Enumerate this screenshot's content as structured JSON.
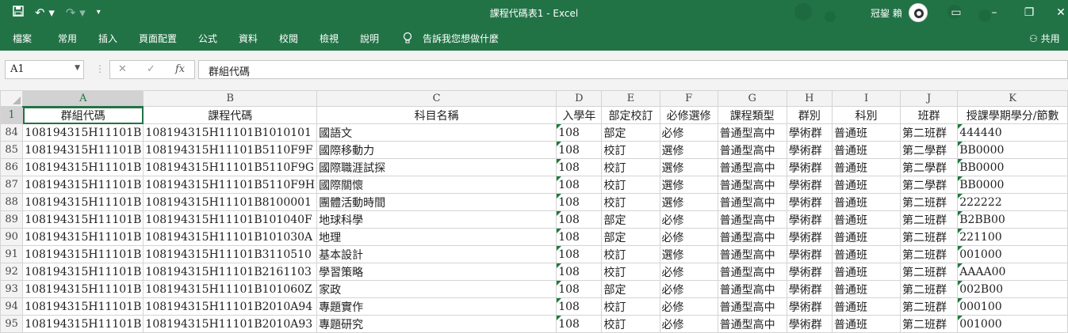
{
  "title": "課程代碼表1 - Excel",
  "user": "冠鋆 賴",
  "ribbon_tabs": [
    "檔案",
    "常用",
    "插入",
    "頁面配置",
    "公式",
    "資料",
    "校閱",
    "檢視",
    "說明"
  ],
  "tell_me": "告訴我您想做什麼",
  "share": "共用",
  "formula_bar": {
    "name_box": "A1",
    "formula": "群組代碼"
  },
  "columns": [
    "A",
    "B",
    "C",
    "D",
    "E",
    "F",
    "G",
    "H",
    "I",
    "J",
    "K"
  ],
  "header_row": {
    "row_number": "1",
    "cells": [
      "群組代碼",
      "課程代碼",
      "科目名稱",
      "入學年",
      "部定校訂",
      "必修選修",
      "課程類型",
      "群別",
      "科別",
      "班群",
      "授課學期學分/節數"
    ]
  },
  "rows": [
    {
      "n": "84",
      "c": [
        "108194315H11101B",
        "108194315H11101B1010101",
        "國語文",
        "108",
        "部定",
        "必修",
        "普通型高中",
        "學術群",
        "普通班",
        "第二班群",
        "444440"
      ]
    },
    {
      "n": "85",
      "c": [
        "108194315H11101B",
        "108194315H11101B5110F9F",
        "國際移動力",
        "108",
        "校訂",
        "選修",
        "普通型高中",
        "學術群",
        "普通班",
        "第二學群",
        "BB0000"
      ]
    },
    {
      "n": "86",
      "c": [
        "108194315H11101B",
        "108194315H11101B5110F9G",
        "國際職涯試探",
        "108",
        "校訂",
        "選修",
        "普通型高中",
        "學術群",
        "普通班",
        "第二學群",
        "BB0000"
      ]
    },
    {
      "n": "87",
      "c": [
        "108194315H11101B",
        "108194315H11101B5110F9H",
        "國際關懷",
        "108",
        "校訂",
        "選修",
        "普通型高中",
        "學術群",
        "普通班",
        "第二學群",
        "BB0000"
      ]
    },
    {
      "n": "88",
      "c": [
        "108194315H11101B",
        "108194315H11101B8100001",
        "團體活動時間",
        "108",
        "校訂",
        "選修",
        "普通型高中",
        "學術群",
        "普通班",
        "第二班群",
        "222222"
      ]
    },
    {
      "n": "89",
      "c": [
        "108194315H11101B",
        "108194315H11101B101040F",
        "地球科學",
        "108",
        "部定",
        "必修",
        "普通型高中",
        "學術群",
        "普通班",
        "第二班群",
        "B2BB00"
      ]
    },
    {
      "n": "90",
      "c": [
        "108194315H11101B",
        "108194315H11101B101030A",
        "地理",
        "108",
        "部定",
        "必修",
        "普通型高中",
        "學術群",
        "普通班",
        "第二班群",
        "221100"
      ]
    },
    {
      "n": "91",
      "c": [
        "108194315H11101B",
        "108194315H11101B3110510",
        "基本設計",
        "108",
        "校訂",
        "選修",
        "普通型高中",
        "學術群",
        "普通班",
        "第二班群",
        "001000"
      ]
    },
    {
      "n": "92",
      "c": [
        "108194315H11101B",
        "108194315H11101B2161103",
        "學習策略",
        "108",
        "校訂",
        "必修",
        "普通型高中",
        "學術群",
        "普通班",
        "第二班群",
        "AAAA00"
      ]
    },
    {
      "n": "93",
      "c": [
        "108194315H11101B",
        "108194315H11101B101060Z",
        "家政",
        "108",
        "部定",
        "必修",
        "普通型高中",
        "學術群",
        "普通班",
        "第二班群",
        "002B00"
      ]
    },
    {
      "n": "94",
      "c": [
        "108194315H11101B",
        "108194315H11101B2010A94",
        "專題實作",
        "108",
        "校訂",
        "必修",
        "普通型高中",
        "學術群",
        "普通班",
        "第二班群",
        "000100"
      ]
    },
    {
      "n": "95",
      "c": [
        "108194315H11101B",
        "108194315H11101B2010A93",
        "專題研究",
        "108",
        "校訂",
        "必修",
        "普通型高中",
        "學術群",
        "普通班",
        "第二班群",
        "001000"
      ]
    }
  ]
}
